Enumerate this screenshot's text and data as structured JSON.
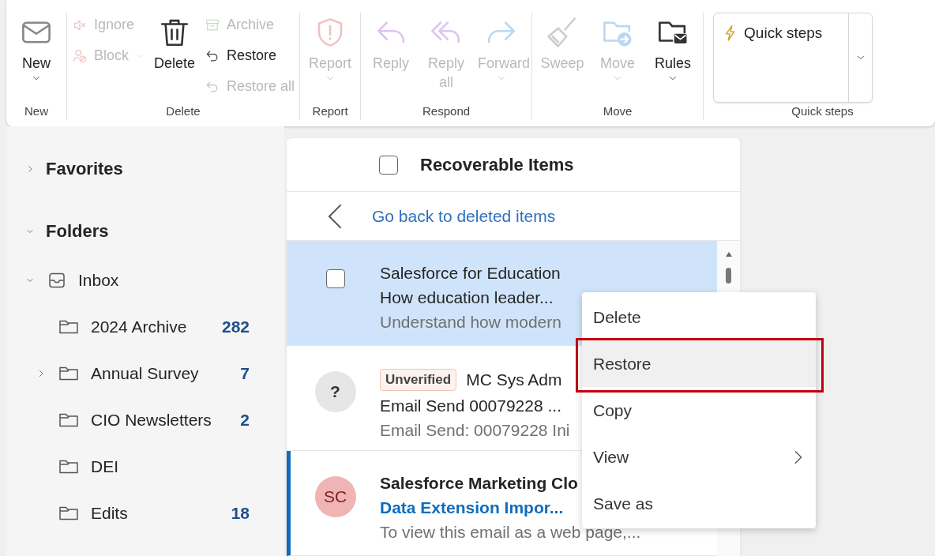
{
  "ribbon": {
    "groups": [
      {
        "label": "New",
        "buttons": [
          {
            "kind": "large",
            "label": "New",
            "disabled": false,
            "dropdown": true
          }
        ]
      },
      {
        "label": "Delete",
        "buttons": [
          {
            "kind": "small",
            "label": "Ignore",
            "disabled": true,
            "dropdown": false
          },
          {
            "kind": "small",
            "label": "Block",
            "disabled": true,
            "dropdown": true
          },
          {
            "kind": "large",
            "label": "Delete",
            "disabled": false,
            "dropdown": false
          },
          {
            "kind": "small",
            "label": "Archive",
            "disabled": true,
            "dropdown": false
          },
          {
            "kind": "small",
            "label": "Restore",
            "disabled": false,
            "dropdown": false
          },
          {
            "kind": "small",
            "label": "Restore all",
            "disabled": true,
            "dropdown": false
          }
        ]
      },
      {
        "label": "Report",
        "buttons": [
          {
            "kind": "large",
            "label": "Report",
            "disabled": true,
            "dropdown": true
          }
        ]
      },
      {
        "label": "Respond",
        "buttons": [
          {
            "kind": "large",
            "label": "Reply",
            "disabled": true,
            "dropdown": false
          },
          {
            "kind": "large",
            "label": "Reply all",
            "disabled": true,
            "dropdown": false
          },
          {
            "kind": "large",
            "label": "Forward",
            "disabled": true,
            "dropdown": true
          }
        ]
      },
      {
        "label": "Move",
        "buttons": [
          {
            "kind": "large",
            "label": "Sweep",
            "disabled": true,
            "dropdown": false
          },
          {
            "kind": "large",
            "label": "Move",
            "disabled": true,
            "dropdown": true
          },
          {
            "kind": "large",
            "label": "Rules",
            "disabled": false,
            "dropdown": true
          }
        ]
      },
      {
        "label": "Quick steps",
        "buttons": [
          {
            "kind": "gallery",
            "label": "Quick steps",
            "disabled": false,
            "dropdown": true
          }
        ]
      }
    ]
  },
  "sidebar": {
    "items": [
      {
        "label": "Favorites",
        "kind": "section",
        "expanded": false
      },
      {
        "label": "Folders",
        "kind": "section",
        "expanded": true,
        "children": [
          {
            "label": "Inbox",
            "kind": "inbox",
            "expanded": true,
            "children": [
              {
                "label": "2024 Archive",
                "kind": "folder",
                "count": "282"
              },
              {
                "label": "Annual Survey",
                "kind": "folder",
                "count": "7",
                "expanded": false
              },
              {
                "label": "CIO Newsletters",
                "kind": "folder",
                "count": "2"
              },
              {
                "label": "DEI",
                "kind": "folder"
              },
              {
                "label": "Edits",
                "kind": "folder",
                "count": "18"
              }
            ]
          }
        ]
      }
    ]
  },
  "message_list": {
    "title": "Recoverable Items",
    "select_all_checked": false,
    "back_link": "Go back to deleted items",
    "messages": [
      {
        "kind": "checkbox",
        "checked": false,
        "selected": true,
        "unread": false,
        "sender": "Salesforce for Education",
        "subject": "How education leader...",
        "preview": "Understand how modern"
      },
      {
        "kind": "unknown",
        "avatar_text": "?",
        "tag": "Unverified",
        "selected": false,
        "unread": false,
        "sender": "MC Sys Adm",
        "subject": "Email Send 00079228 ...",
        "preview": "Email Send: 00079228 Ini"
      },
      {
        "kind": "initials",
        "avatar_text": "SC",
        "selected": false,
        "unread": true,
        "sender": "Salesforce Marketing Clo",
        "subject": "Data Extension Impor...",
        "preview": "To view this email as a web page,..."
      }
    ]
  },
  "context_menu": {
    "items": [
      {
        "label": "Delete",
        "highlighted": false,
        "submenu": false
      },
      {
        "label": "Restore",
        "highlighted": true,
        "submenu": false
      },
      {
        "label": "Copy",
        "highlighted": false,
        "submenu": false
      },
      {
        "label": "View",
        "highlighted": false,
        "submenu": true
      },
      {
        "label": "Save as",
        "highlighted": false,
        "submenu": false
      }
    ]
  }
}
